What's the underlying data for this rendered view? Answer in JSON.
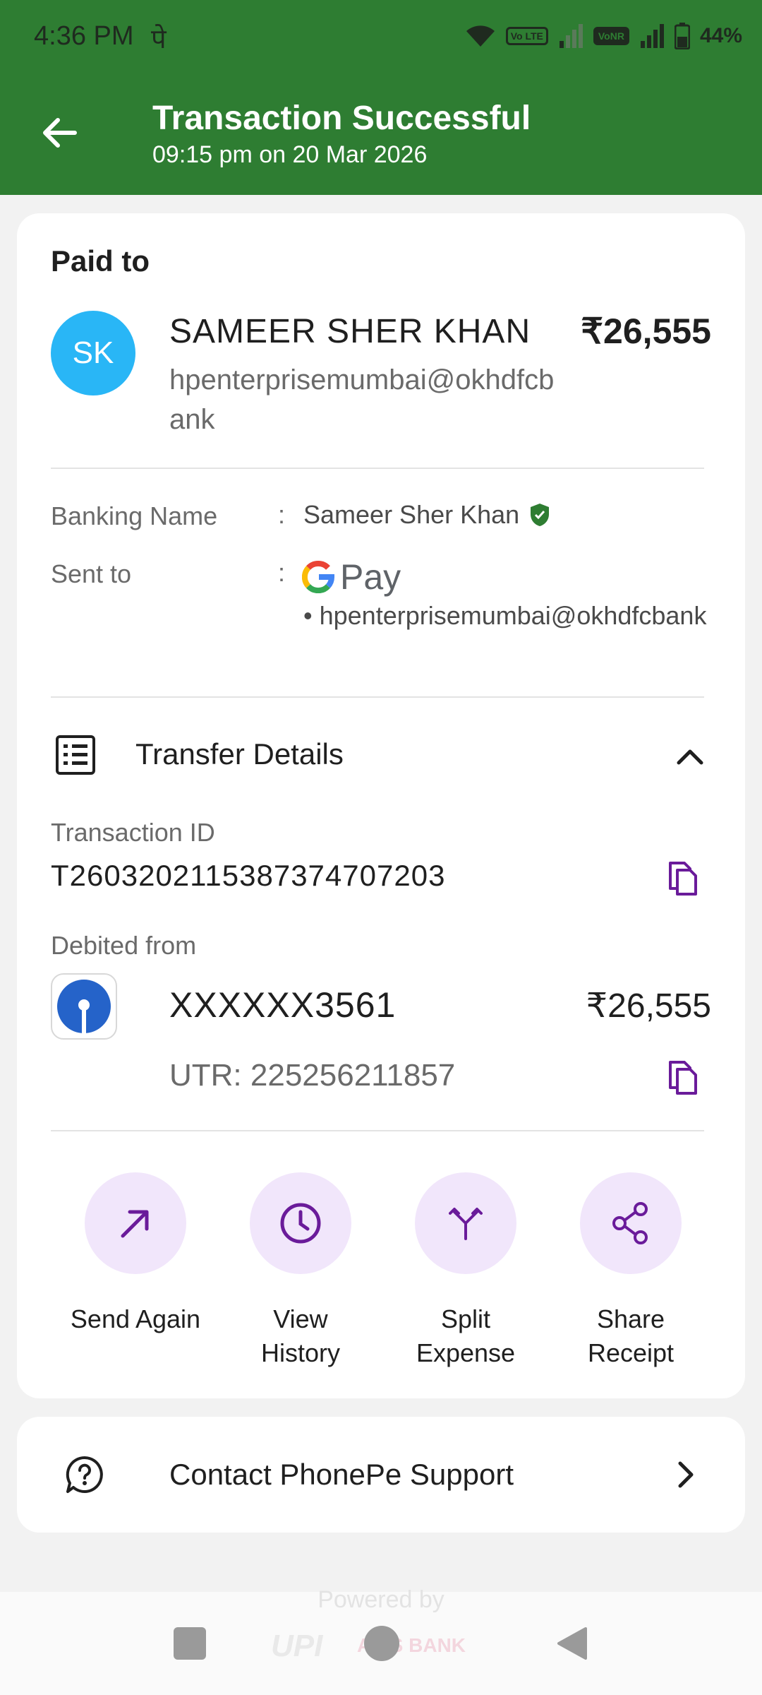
{
  "status_bar": {
    "time": "4:36 PM",
    "carrier_glyph": "पे",
    "volte_label": "Vo LTE",
    "vonr_label": "VoNR",
    "battery": "44%"
  },
  "header": {
    "title": "Transaction Successful",
    "subtitle": "09:15 pm on 20 Mar 2026",
    "background_color": "#2e7d32"
  },
  "payee": {
    "section_label": "Paid to",
    "initials": "SK",
    "name": "SAMEER SHER KHAN",
    "vpa": "hpenterprisemumbai@okhdfcbank",
    "amount": "₹26,555",
    "avatar_color": "#29b6f6"
  },
  "details": {
    "banking_name_label": "Banking Name",
    "banking_name_value": "Sameer Sher Khan",
    "sent_to_label": "Sent to",
    "colon": ":",
    "sent_to_app": "Pay",
    "sent_to_vpa": "• hpenterprisemumbai@okhdfcbank"
  },
  "transfer": {
    "section_label": "Transfer Details",
    "txn_id_label": "Transaction ID",
    "txn_id": "T2603202115387374707203",
    "debited_from_label": "Debited from",
    "account": "XXXXXX3561",
    "account_amount": "₹26,555",
    "utr": "UTR: 225256211857"
  },
  "actions": [
    {
      "label": "Send Again",
      "icon": "arrow-up-right-icon"
    },
    {
      "label": "View\nHistory",
      "icon": "clock-icon"
    },
    {
      "label": "Split\nExpense",
      "icon": "split-icon"
    },
    {
      "label": "Share\nReceipt",
      "icon": "share-icon"
    }
  ],
  "support": {
    "label": "Contact PhonePe Support"
  },
  "footer": {
    "powered_by": "Powered by",
    "upi": "UPI",
    "partner": "AXIS BANK"
  },
  "colors": {
    "accent_purple": "#6a1b9a",
    "action_bg": "#f1e6fb",
    "verified_green": "#2e7d32"
  }
}
